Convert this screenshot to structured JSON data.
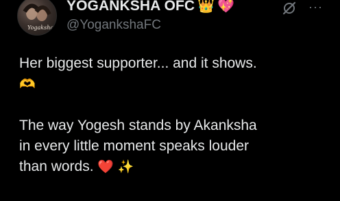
{
  "author": {
    "display_name": "YOGANKSHA OFC",
    "badges": [
      "👑",
      "💖"
    ],
    "handle": "@YogankshaFC",
    "avatar_text": "Yogaksha"
  },
  "tweet": {
    "line1": "Her biggest supporter... and it shows.",
    "line1_emoji": "🫶",
    "paragraph2_line1": "The way Yogesh stands by Akanksha",
    "paragraph2_line2": "in every little moment speaks louder",
    "paragraph2_line3": "than words.",
    "paragraph2_emojis": [
      "❤️",
      "✨"
    ]
  },
  "icons": {
    "grok": "grok-icon",
    "more": "more-options-icon",
    "more_glyph": "···"
  }
}
